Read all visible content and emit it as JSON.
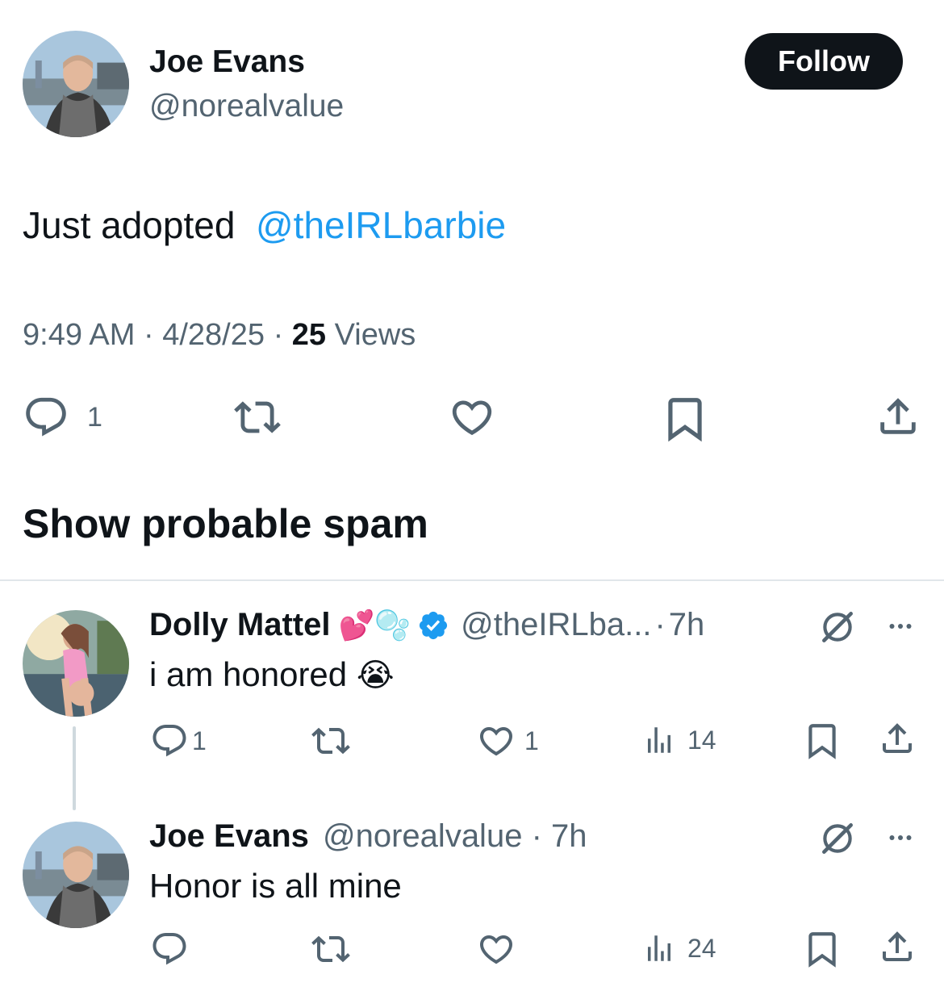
{
  "tweet": {
    "author_name": "Joe Evans",
    "author_handle": "@norealvalue",
    "follow_label": "Follow",
    "text": "Just adopted",
    "mention": "@theIRLbarbie",
    "time": "9:49 AM",
    "sep1": "·",
    "date": "4/28/25",
    "sep2": "·",
    "views_count": "25",
    "views_label": "Views",
    "reply_count": "1",
    "icons": [
      "reply-icon",
      "retweet-icon",
      "like-icon",
      "bookmark-icon",
      "share-icon"
    ]
  },
  "spam_toggle": "Show probable spam",
  "replies": [
    {
      "name": "Dolly Mattel",
      "name_emoji": "💕🫧",
      "verified": true,
      "handle": "@theIRLba...",
      "sep": "·",
      "time": "7h",
      "text": "i am honored",
      "text_emoji": "😭",
      "reply_count": "1",
      "like_count": "1",
      "views_count": "14"
    },
    {
      "name": "Joe Evans",
      "handle": "@norealvalue",
      "sep": "·",
      "time": "7h",
      "text": "Honor is all mine",
      "views_count": "24"
    }
  ],
  "colors": {
    "text": "#0f1419",
    "muted": "#536471",
    "link": "#1d9bf0",
    "verified": "#1d9bf0",
    "follow_bg": "#0f1419"
  }
}
